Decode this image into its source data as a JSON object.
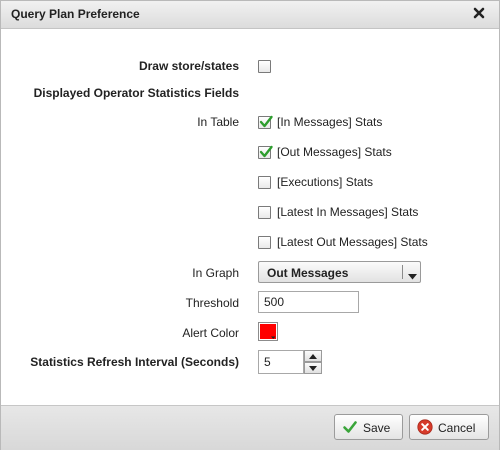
{
  "dialog": {
    "title": "Query Plan Preference"
  },
  "form": {
    "draw_store_states": {
      "label": "Draw store/states",
      "checked": false
    },
    "displayed_fields_label": "Displayed Operator Statistics Fields",
    "in_table_label": "In Table",
    "in_table_options": [
      {
        "label": "[In Messages] Stats",
        "checked": true
      },
      {
        "label": "[Out Messages] Stats",
        "checked": true
      },
      {
        "label": "[Executions] Stats",
        "checked": false
      },
      {
        "label": "[Latest In Messages] Stats",
        "checked": false
      },
      {
        "label": "[Latest Out Messages] Stats",
        "checked": false
      }
    ],
    "in_graph_label": "In Graph",
    "in_graph_value": "Out Messages",
    "threshold_label": "Threshold",
    "threshold_value": "500",
    "alert_color_label": "Alert Color",
    "alert_color": "#ff0000",
    "refresh_label": "Statistics Refresh Interval (Seconds)",
    "refresh_value": "5"
  },
  "footer": {
    "save_label": "Save",
    "cancel_label": "Cancel"
  },
  "colors": {
    "check_green": "#2e9e2e",
    "save_icon_green": "#3aa53a",
    "cancel_icon_red": "#d63a2a"
  }
}
